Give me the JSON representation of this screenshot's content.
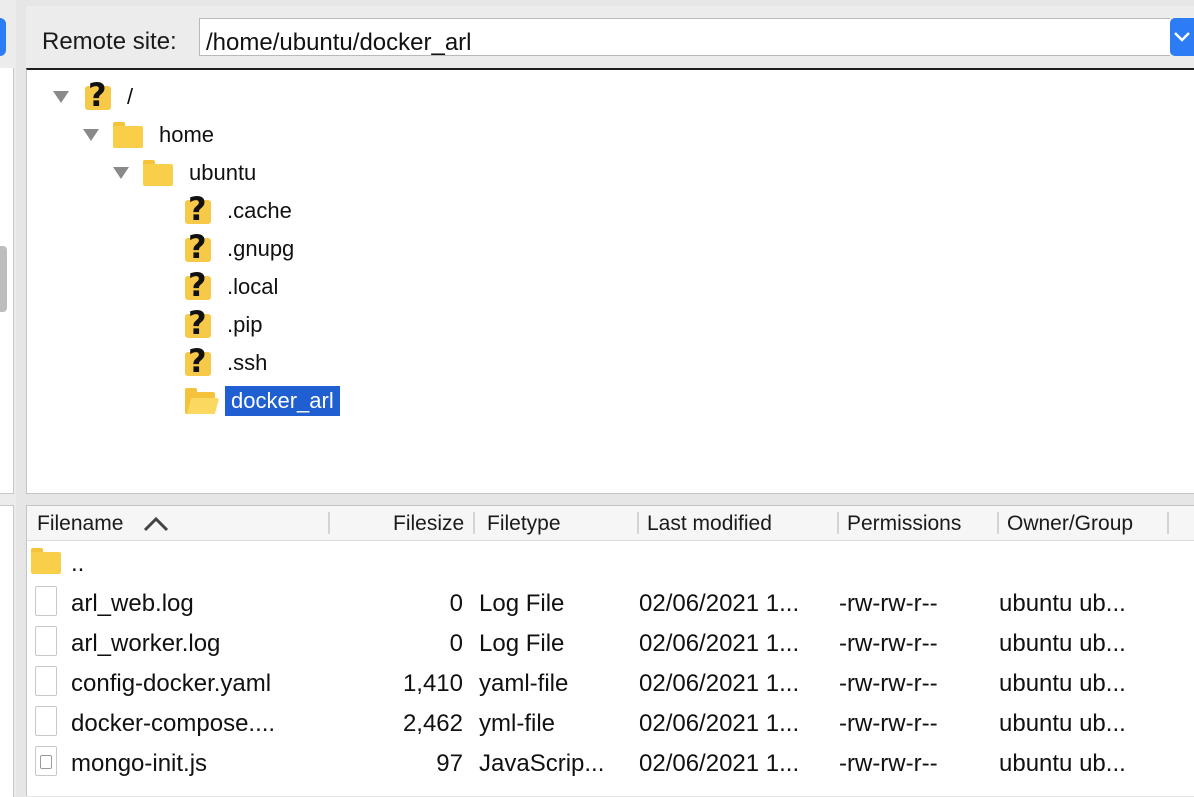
{
  "remote": {
    "label": "Remote site:",
    "path": "/home/ubuntu/docker_arl"
  },
  "tree": {
    "nodes": [
      {
        "label": "/",
        "icon": "unknown-folder-icon",
        "expanded": true
      },
      {
        "label": "home",
        "icon": "folder-icon",
        "expanded": true
      },
      {
        "label": "ubuntu",
        "icon": "folder-icon",
        "expanded": true
      },
      {
        "label": ".cache",
        "icon": "unknown-folder-icon"
      },
      {
        "label": ".gnupg",
        "icon": "unknown-folder-icon"
      },
      {
        "label": ".local",
        "icon": "unknown-folder-icon"
      },
      {
        "label": ".pip",
        "icon": "unknown-folder-icon"
      },
      {
        "label": ".ssh",
        "icon": "unknown-folder-icon"
      },
      {
        "label": "docker_arl",
        "icon": "open-folder-icon",
        "selected": true
      }
    ]
  },
  "list": {
    "columns": {
      "filename": "Filename",
      "filesize": "Filesize",
      "filetype": "Filetype",
      "modified": "Last modified",
      "permissions": "Permissions",
      "owner": "Owner/Group"
    },
    "sort_icon": "sort-ascending-icon",
    "parent": "..",
    "rows": [
      {
        "name": "arl_web.log",
        "size": "0",
        "type": "Log File",
        "modified": "02/06/2021 1...",
        "perms": "-rw-rw-r--",
        "owner": "ubuntu ub...",
        "icon": "file-icon"
      },
      {
        "name": "arl_worker.log",
        "size": "0",
        "type": "Log File",
        "modified": "02/06/2021 1...",
        "perms": "-rw-rw-r--",
        "owner": "ubuntu ub...",
        "icon": "file-icon"
      },
      {
        "name": "config-docker.yaml",
        "size": "1,410",
        "type": "yaml-file",
        "modified": "02/06/2021 1...",
        "perms": "-rw-rw-r--",
        "owner": "ubuntu ub...",
        "icon": "file-icon"
      },
      {
        "name": "docker-compose....",
        "size": "2,462",
        "type": "yml-file",
        "modified": "02/06/2021 1...",
        "perms": "-rw-rw-r--",
        "owner": "ubuntu ub...",
        "icon": "file-icon"
      },
      {
        "name": "mongo-init.js",
        "size": "97",
        "type": "JavaScrip...",
        "modified": "02/06/2021 1...",
        "perms": "-rw-rw-r--",
        "owner": "ubuntu ub...",
        "icon": "javascript-file-icon"
      }
    ]
  },
  "colors": {
    "selection": "#1f5fd1",
    "accent": "#2c7cf6",
    "folder": "#f9cf4a"
  }
}
